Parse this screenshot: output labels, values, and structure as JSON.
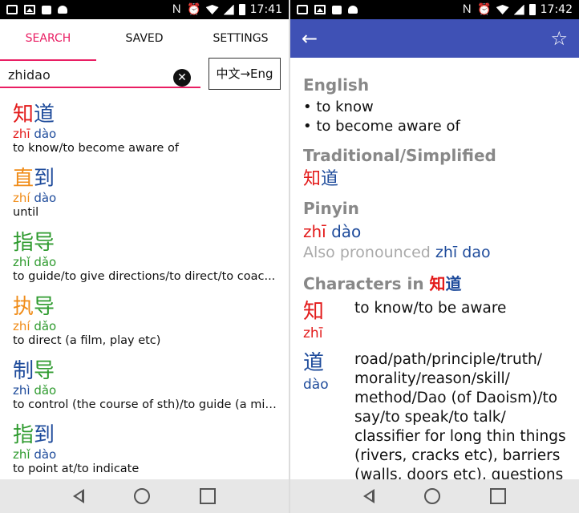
{
  "status_left": {
    "time": "17:41"
  },
  "status_right": {
    "time": "17:42"
  },
  "tabs": [
    {
      "label": "SEARCH"
    },
    {
      "label": "SAVED"
    },
    {
      "label": "SETTINGS"
    }
  ],
  "search": {
    "value": "zhidao",
    "lang_toggle": "中文→Eng"
  },
  "results": [
    {
      "c1": "知",
      "c2": "道",
      "p1": "zhī",
      "p2": "dào",
      "gloss": "to know/to become aware of",
      "col1": "red",
      "col2": "blue"
    },
    {
      "c1": "直",
      "c2": "到",
      "p1": "zhí",
      "p2": "dào",
      "gloss": "until",
      "col1": "orange",
      "col2": "blue"
    },
    {
      "c1": "指",
      "c2": "导",
      "p1": "zhǐ",
      "p2": "dǎo",
      "gloss": "to guide/to give directions/to direct/to coac...",
      "col1": "green",
      "col2": "green"
    },
    {
      "c1": "执",
      "c2": "导",
      "p1": "zhí",
      "p2": "dǎo",
      "gloss": "to direct (a film, play etc)",
      "col1": "orange",
      "col2": "green"
    },
    {
      "c1": "制",
      "c2": "导",
      "p1": "zhì",
      "p2": "dǎo",
      "gloss": "to control (the course of sth)/to guide (a mis...",
      "col1": "blue",
      "col2": "green"
    },
    {
      "c1": "指",
      "c2": "到",
      "p1": "zhǐ",
      "p2": "dào",
      "gloss": "to point at/to indicate",
      "col1": "green",
      "col2": "blue"
    }
  ],
  "detail": {
    "english_head": "English",
    "english_items": [
      "• to know",
      "• to become aware of"
    ],
    "trad_head": "Traditional/Simplified",
    "trad_c1": "知",
    "trad_c2": "道",
    "pinyin_head": "Pinyin",
    "pinyin_p1": "zhī",
    "pinyin_p2": "dào",
    "also_text": "Also pronounced",
    "also_p1": "zhī",
    "also_p2": "dao",
    "chars_head": "Characters in",
    "chars_c1": "知",
    "chars_c2": "道",
    "chars": [
      {
        "glyph": "知",
        "py": "zhī",
        "def": "to know/to be aware",
        "color": "red"
      },
      {
        "glyph": "道",
        "py": "dào",
        "def": "road/path/principle/truth/ morality/reason/skill/ method/Dao (of Daoism)/to say/to speak/to talk/ classifier for long thin things (rivers, cracks etc), barriers (walls, doors etc), questions",
        "color": "blue"
      }
    ]
  }
}
